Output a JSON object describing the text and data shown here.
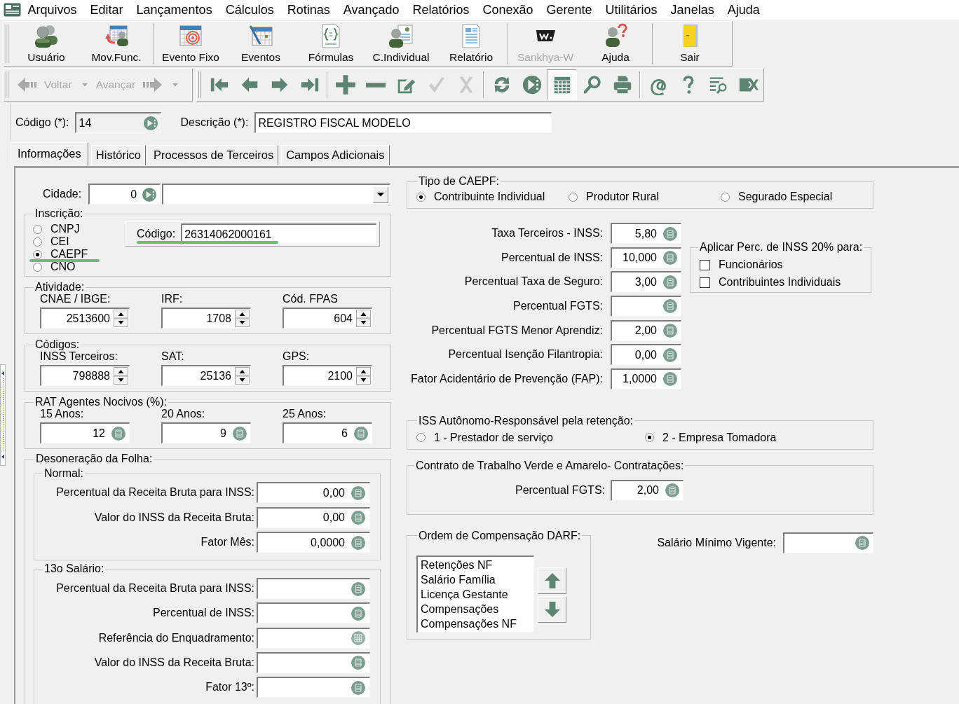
{
  "menu_bar": [
    "Arquivos",
    "Editar",
    "Lançamentos",
    "Cálculos",
    "Rotinas",
    "Avançado",
    "Relatórios",
    "Conexão",
    "Gerente",
    "Utilitários",
    "Janelas",
    "Ajuda"
  ],
  "main_toolbar": [
    {
      "buttons": [
        {
          "kind": "user",
          "label": "Usuário",
          "disabled": false
        },
        {
          "kind": "movement",
          "label": "Mov.Func.",
          "disabled": false
        }
      ]
    },
    {
      "buttons": [
        {
          "kind": "fixedevent",
          "label": "Evento Fixo",
          "disabled": false
        },
        {
          "kind": "events",
          "label": "Eventos",
          "disabled": false
        },
        {
          "kind": "formulas",
          "label": "Fórmulas",
          "disabled": false
        },
        {
          "kind": "individual",
          "label": "C.Individual",
          "disabled": false
        },
        {
          "kind": "report",
          "label": "Relatório",
          "disabled": false
        }
      ]
    },
    {
      "buttons": [
        {
          "kind": "portal",
          "label": "Sankhya-W",
          "disabled": true
        },
        {
          "kind": "help",
          "label": "Ajuda",
          "disabled": false
        }
      ]
    },
    {
      "buttons": [
        {
          "kind": "exit",
          "label": "Sair",
          "disabled": false
        }
      ]
    }
  ],
  "history_toolbar": [
    {
      "kind": "back",
      "label": "Voltar",
      "disabled": true
    },
    {
      "kind": "forward",
      "label": "Avançar",
      "disabled": true
    }
  ],
  "record_toolbar": [
    {
      "buttons": [
        {
          "kind": "first",
          "disabled": false,
          "pressed": false
        },
        {
          "kind": "previous",
          "disabled": false,
          "pressed": false
        },
        {
          "kind": "next",
          "disabled": false,
          "pressed": false
        },
        {
          "kind": "last",
          "disabled": false,
          "pressed": false
        }
      ]
    },
    {
      "buttons": [
        {
          "kind": "insert",
          "disabled": false,
          "pressed": false
        },
        {
          "kind": "delete",
          "disabled": false,
          "pressed": false
        },
        {
          "kind": "edit",
          "disabled": false,
          "pressed": false
        },
        {
          "kind": "confirm",
          "disabled": true,
          "pressed": false
        },
        {
          "kind": "cancel",
          "disabled": true,
          "pressed": false
        }
      ]
    },
    {
      "buttons": [
        {
          "kind": "refresh",
          "disabled": false,
          "pressed": false
        },
        {
          "kind": "execute",
          "disabled": false,
          "pressed": false
        },
        {
          "kind": "grid",
          "disabled": false,
          "pressed": true
        },
        {
          "kind": "search",
          "disabled": false,
          "pressed": false
        },
        {
          "kind": "print",
          "disabled": false,
          "pressed": false
        }
      ]
    },
    {
      "buttons": [
        {
          "kind": "email",
          "disabled": false,
          "pressed": false
        },
        {
          "kind": "help",
          "disabled": false,
          "pressed": false
        },
        {
          "kind": "find",
          "disabled": false,
          "pressed": false
        },
        {
          "kind": "export",
          "disabled": false,
          "pressed": false
        }
      ]
    }
  ],
  "record": {
    "code_label": "Código (*):",
    "code": "14",
    "code_read_only": true,
    "description_label": "Descrição (*):",
    "description": "REGISTRO FISCAL MODELO"
  },
  "tabs": [
    {
      "label": "Informações",
      "selected": true
    },
    {
      "label": "Histórico",
      "selected": false
    },
    {
      "label": "Processos de Terceiros",
      "selected": false
    },
    {
      "label": "Campos Adicionais",
      "selected": false
    }
  ],
  "informacoes": {
    "cidade": {
      "label": "Cidade:",
      "code": "0"
    },
    "inscricao": {
      "title": "Inscrição:",
      "options": [
        {
          "label": "CNPJ",
          "selected": false
        },
        {
          "label": "CEI",
          "selected": false
        },
        {
          "label": "CAEPF",
          "selected": true
        },
        {
          "label": "CNO",
          "selected": false
        }
      ],
      "code_label": "Código:",
      "code": "26314062000161"
    },
    "code_groups": [
      {
        "title": "Atividade:",
        "kind": "spinner",
        "fields": [
          {
            "label": "CNAE / IBGE:",
            "value": "2513600"
          },
          {
            "label": "IRF:",
            "value": "1708"
          },
          {
            "label": "Cód. FPAS",
            "value": "604"
          }
        ]
      },
      {
        "title": "Códigos:",
        "kind": "spinner",
        "fields": [
          {
            "label": "INSS Terceiros:",
            "value": "798888"
          },
          {
            "label": "SAT:",
            "value": "25136"
          },
          {
            "label": "GPS:",
            "value": "2100"
          }
        ]
      },
      {
        "title": "RAT Agentes Nocivos (%):",
        "kind": "calc",
        "fields": [
          {
            "label": "15 Anos:",
            "value": "12"
          },
          {
            "label": "20 Anos:",
            "value": "9"
          },
          {
            "label": "25 Anos:",
            "value": "6"
          }
        ]
      }
    ],
    "desoneracao": {
      "title": "Desoneração da Folha:",
      "sections": [
        {
          "title": "Normal:",
          "rows": [
            {
              "label": "Percentual da Receita Bruta para INSS:",
              "value": "0,00",
              "kind": "calc"
            },
            {
              "label": "Valor do INSS da Receita Bruta:",
              "value": "0,00",
              "kind": "calc"
            },
            {
              "label": "Fator Mês:",
              "value": "0,0000",
              "kind": "calc"
            }
          ]
        },
        {
          "title": "13o Salário:",
          "rows": [
            {
              "label": "Percentual da Receita Bruta para INSS:",
              "kind": "calc"
            },
            {
              "label": "Percentual de INSS:",
              "kind": "calc"
            },
            {
              "label": "Referência do Enquadramento:",
              "kind": "lookup"
            },
            {
              "label": "Valor do INSS da Receita Bruta:",
              "kind": "calc"
            },
            {
              "label": "Fator 13º:",
              "kind": "calc"
            }
          ]
        }
      ]
    },
    "tipo_caepf": {
      "title": "Tipo de CAEPF:",
      "options": [
        {
          "label": "Contribuinte Individual",
          "selected": true
        },
        {
          "label": "Produtor Rural",
          "selected": false
        },
        {
          "label": "Segurado Especial",
          "selected": false
        }
      ]
    },
    "taxas": [
      {
        "label": "Taxa Terceiros - INSS:",
        "value": "5,80"
      },
      {
        "label": "Percentual de INSS:",
        "value": "10,000"
      },
      {
        "label": "Percentual Taxa de Seguro:",
        "value": "3,00"
      },
      {
        "label": "Percentual FGTS:"
      },
      {
        "label": "Percentual FGTS Menor Aprendiz:",
        "value": "2,00"
      },
      {
        "label": "Percentual Isenção Filantropia:",
        "value": "0,00"
      },
      {
        "label": "Fator Acidentário de Prevenção (FAP):",
        "value": "1,0000"
      }
    ],
    "aplicar_inss": {
      "title": "Aplicar Perc. de INSS 20% para:",
      "options": [
        {
          "label": "Funcionários",
          "checked": false
        },
        {
          "label": "Contribuintes Individuais",
          "checked": false
        }
      ]
    },
    "iss_autonomo": {
      "title": "ISS Autônomo-Responsável pela retenção:",
      "options": [
        {
          "label": "1 - Prestador de serviço",
          "selected": false
        },
        {
          "label": "2 - Empresa Tomadora",
          "selected": true
        }
      ]
    },
    "contrato_verde_amarelo": {
      "title": "Contrato de Trabalho Verde e Amarelo- Contratações:",
      "label": "Percentual FGTS:",
      "value": "2,00"
    },
    "ordem_darf": {
      "title": "Ordem de Compensação DARF:",
      "items": [
        "Retenções NF",
        "Salário Família",
        "Licença Gestante",
        "Compensações",
        "Compensações NF"
      ]
    },
    "salario_minimo": {
      "label": "Salário Mínimo Vigente:"
    }
  }
}
